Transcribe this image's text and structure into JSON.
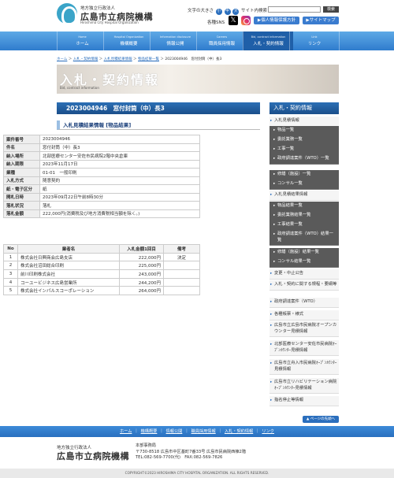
{
  "header": {
    "org_sub": "地方独立行政法人",
    "org_name": "広島市立病院機構",
    "org_en": "Hiroshima City Hospital Organization",
    "font_size_label": "文字の大きさ",
    "font_small": "小",
    "font_medium": "中",
    "font_large": "大",
    "search_label": "サイト内検索",
    "search_value": "",
    "search_button": "検索",
    "sns_label": "各種SNS",
    "privacy_button": "▶個人情報保護方針",
    "sitemap_button": "▶サイトマップ"
  },
  "nav": [
    {
      "en": "Home",
      "ja": "ホーム"
    },
    {
      "en": "Hospital Organization",
      "ja": "機構概要"
    },
    {
      "en": "Information disclosure",
      "ja": "情報公開"
    },
    {
      "en": "Careers",
      "ja": "職員採用情報"
    },
    {
      "en": "Bid, contract information",
      "ja": "入札・契約情報"
    },
    {
      "en": "Link",
      "ja": "リンク"
    }
  ],
  "breadcrumb": [
    "ホーム",
    "入札・契約情報",
    "入札見積結果情報",
    "物品結果一覧",
    "2023004946　窓付封筒（中）長3"
  ],
  "banner": {
    "title": "入札・契約情報",
    "subtitle": "Bid, contract information"
  },
  "page_title": "2023004946　窓付封筒（中）長3",
  "section_title": "入札見積結果情報 [物品結果]",
  "info_rows": [
    {
      "k": "案件番号",
      "v": "2023004946"
    },
    {
      "k": "件名",
      "v": "窓付封筒（中）長3"
    },
    {
      "k": "納入場所",
      "v": "北部医療センター安佐市民病院2階中央倉庫"
    },
    {
      "k": "納入期限",
      "v": "2023年11月17日"
    },
    {
      "k": "業種",
      "v": "01-01　一般印刷"
    },
    {
      "k": "入札方式",
      "v": "随意契約"
    },
    {
      "k": "紙・電子区分",
      "v": "紙"
    },
    {
      "k": "開札日時",
      "v": "2023年09月22日午前8時30分"
    },
    {
      "k": "落札状況",
      "v": "落札"
    },
    {
      "k": "落札金額",
      "v": "222,000円(消費税及び地方消費税相当額を除く。)"
    }
  ],
  "bid_headers": [
    "No",
    "業者名",
    "入札金額1回目",
    "備考"
  ],
  "bids": [
    {
      "no": "1",
      "name": "株式会社日興商会広島支店",
      "amount": "222,000円",
      "note": "決定"
    },
    {
      "no": "2",
      "name": "株式会社沼田総合印刷",
      "amount": "225,000円",
      "note": ""
    },
    {
      "no": "3",
      "name": "前川印刷株式会社",
      "amount": "243,000円",
      "note": ""
    },
    {
      "no": "4",
      "name": "コーユービジネス広島営業所",
      "amount": "244,200円",
      "note": ""
    },
    {
      "no": "5",
      "name": "株式会社インパルスコーポレーション",
      "amount": "264,000円",
      "note": ""
    }
  ],
  "sidebar": {
    "title": "入札・契約情報",
    "items": [
      {
        "label": "入札見積情報",
        "level": 1
      },
      {
        "label": "物品一覧",
        "level": 2
      },
      {
        "label": "委託業務一覧",
        "level": 2
      },
      {
        "label": "工事一覧",
        "level": 2
      },
      {
        "label": "政府調達案件（WTO）一覧",
        "level": 2
      },
      {
        "label": "修繕（施設）一覧",
        "level": 2
      },
      {
        "label": "コンサル一覧",
        "level": 2
      },
      {
        "label": "入札見積結果情報",
        "level": 1
      },
      {
        "label": "物品結果一覧",
        "level": 2
      },
      {
        "label": "委託業務結果一覧",
        "level": 2
      },
      {
        "label": "工事結果一覧",
        "level": 2
      },
      {
        "label": "政府調達案件（WTO）結果一覧",
        "level": 2
      },
      {
        "label": "修繕（施設）結果一覧",
        "level": 2
      },
      {
        "label": "コンサル結果一覧",
        "level": 2
      },
      {
        "label": "変更・中止公告",
        "level": 1
      },
      {
        "label": "入札・契約に関する規程・要綱等",
        "level": 1
      },
      {
        "label": "政府調達案件（WTO）",
        "level": 1
      },
      {
        "label": "各種帳票・様式",
        "level": 1
      },
      {
        "label": "広島市立広島市民病院オープンカウンター見積情報",
        "level": 1
      },
      {
        "label": "北部医療センター安佐市民病院ｵｰﾌﾟﾝｶｳﾝﾀｰ見積情報",
        "level": 1
      },
      {
        "label": "広島市立舟入市民病院ｵｰﾌﾟﾝｶｳﾝﾀｰ見積情報",
        "level": 1
      },
      {
        "label": "広島市立リハビリテーション病院ｵｰﾌﾟﾝｶｳﾝﾀｰ見積情報",
        "level": 1
      },
      {
        "label": "指名停止等情報",
        "level": 1
      }
    ]
  },
  "page_top": "▲ ページの先頭へ",
  "footer_nav": [
    "ホーム",
    "機構概要",
    "情報公開",
    "職員採用情報",
    "入札・契約情報",
    "リンク"
  ],
  "footer": {
    "org_sub": "地方独立行政法人",
    "org_name": "広島市立病院機構",
    "office": "本部事務局",
    "address": "〒730-8518 広島市中区基町7番33号 広島市民病院西棟2階",
    "phone": "TEL:082-569-7700(代)　FAX:082-569-7826",
    "copyright": "COPYRIGHT©2023 HIROSHIMA CITY HOSPITAL ORGANIZATION. ALL RIGHTS RESERVED."
  }
}
